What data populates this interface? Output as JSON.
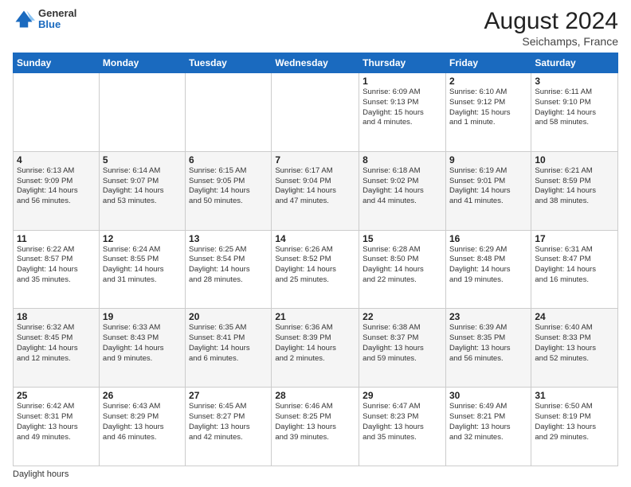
{
  "header": {
    "logo_line1": "General",
    "logo_line2": "Blue",
    "month_year": "August 2024",
    "location": "Seichamps, France"
  },
  "days_of_week": [
    "Sunday",
    "Monday",
    "Tuesday",
    "Wednesday",
    "Thursday",
    "Friday",
    "Saturday"
  ],
  "footer_text": "Daylight hours",
  "weeks": [
    [
      {
        "day": "",
        "info": ""
      },
      {
        "day": "",
        "info": ""
      },
      {
        "day": "",
        "info": ""
      },
      {
        "day": "",
        "info": ""
      },
      {
        "day": "1",
        "info": "Sunrise: 6:09 AM\nSunset: 9:13 PM\nDaylight: 15 hours\nand 4 minutes."
      },
      {
        "day": "2",
        "info": "Sunrise: 6:10 AM\nSunset: 9:12 PM\nDaylight: 15 hours\nand 1 minute."
      },
      {
        "day": "3",
        "info": "Sunrise: 6:11 AM\nSunset: 9:10 PM\nDaylight: 14 hours\nand 58 minutes."
      }
    ],
    [
      {
        "day": "4",
        "info": "Sunrise: 6:13 AM\nSunset: 9:09 PM\nDaylight: 14 hours\nand 56 minutes."
      },
      {
        "day": "5",
        "info": "Sunrise: 6:14 AM\nSunset: 9:07 PM\nDaylight: 14 hours\nand 53 minutes."
      },
      {
        "day": "6",
        "info": "Sunrise: 6:15 AM\nSunset: 9:05 PM\nDaylight: 14 hours\nand 50 minutes."
      },
      {
        "day": "7",
        "info": "Sunrise: 6:17 AM\nSunset: 9:04 PM\nDaylight: 14 hours\nand 47 minutes."
      },
      {
        "day": "8",
        "info": "Sunrise: 6:18 AM\nSunset: 9:02 PM\nDaylight: 14 hours\nand 44 minutes."
      },
      {
        "day": "9",
        "info": "Sunrise: 6:19 AM\nSunset: 9:01 PM\nDaylight: 14 hours\nand 41 minutes."
      },
      {
        "day": "10",
        "info": "Sunrise: 6:21 AM\nSunset: 8:59 PM\nDaylight: 14 hours\nand 38 minutes."
      }
    ],
    [
      {
        "day": "11",
        "info": "Sunrise: 6:22 AM\nSunset: 8:57 PM\nDaylight: 14 hours\nand 35 minutes."
      },
      {
        "day": "12",
        "info": "Sunrise: 6:24 AM\nSunset: 8:55 PM\nDaylight: 14 hours\nand 31 minutes."
      },
      {
        "day": "13",
        "info": "Sunrise: 6:25 AM\nSunset: 8:54 PM\nDaylight: 14 hours\nand 28 minutes."
      },
      {
        "day": "14",
        "info": "Sunrise: 6:26 AM\nSunset: 8:52 PM\nDaylight: 14 hours\nand 25 minutes."
      },
      {
        "day": "15",
        "info": "Sunrise: 6:28 AM\nSunset: 8:50 PM\nDaylight: 14 hours\nand 22 minutes."
      },
      {
        "day": "16",
        "info": "Sunrise: 6:29 AM\nSunset: 8:48 PM\nDaylight: 14 hours\nand 19 minutes."
      },
      {
        "day": "17",
        "info": "Sunrise: 6:31 AM\nSunset: 8:47 PM\nDaylight: 14 hours\nand 16 minutes."
      }
    ],
    [
      {
        "day": "18",
        "info": "Sunrise: 6:32 AM\nSunset: 8:45 PM\nDaylight: 14 hours\nand 12 minutes."
      },
      {
        "day": "19",
        "info": "Sunrise: 6:33 AM\nSunset: 8:43 PM\nDaylight: 14 hours\nand 9 minutes."
      },
      {
        "day": "20",
        "info": "Sunrise: 6:35 AM\nSunset: 8:41 PM\nDaylight: 14 hours\nand 6 minutes."
      },
      {
        "day": "21",
        "info": "Sunrise: 6:36 AM\nSunset: 8:39 PM\nDaylight: 14 hours\nand 2 minutes."
      },
      {
        "day": "22",
        "info": "Sunrise: 6:38 AM\nSunset: 8:37 PM\nDaylight: 13 hours\nand 59 minutes."
      },
      {
        "day": "23",
        "info": "Sunrise: 6:39 AM\nSunset: 8:35 PM\nDaylight: 13 hours\nand 56 minutes."
      },
      {
        "day": "24",
        "info": "Sunrise: 6:40 AM\nSunset: 8:33 PM\nDaylight: 13 hours\nand 52 minutes."
      }
    ],
    [
      {
        "day": "25",
        "info": "Sunrise: 6:42 AM\nSunset: 8:31 PM\nDaylight: 13 hours\nand 49 minutes."
      },
      {
        "day": "26",
        "info": "Sunrise: 6:43 AM\nSunset: 8:29 PM\nDaylight: 13 hours\nand 46 minutes."
      },
      {
        "day": "27",
        "info": "Sunrise: 6:45 AM\nSunset: 8:27 PM\nDaylight: 13 hours\nand 42 minutes."
      },
      {
        "day": "28",
        "info": "Sunrise: 6:46 AM\nSunset: 8:25 PM\nDaylight: 13 hours\nand 39 minutes."
      },
      {
        "day": "29",
        "info": "Sunrise: 6:47 AM\nSunset: 8:23 PM\nDaylight: 13 hours\nand 35 minutes."
      },
      {
        "day": "30",
        "info": "Sunrise: 6:49 AM\nSunset: 8:21 PM\nDaylight: 13 hours\nand 32 minutes."
      },
      {
        "day": "31",
        "info": "Sunrise: 6:50 AM\nSunset: 8:19 PM\nDaylight: 13 hours\nand 29 minutes."
      }
    ]
  ]
}
